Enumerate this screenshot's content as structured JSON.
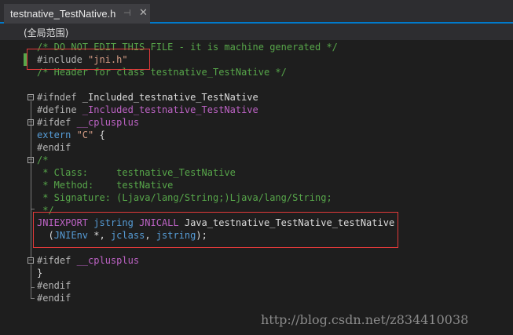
{
  "tab": {
    "title": "testnative_TestNative.h",
    "pin_glyph": "⊣",
    "close_glyph": "✕"
  },
  "navbar": {
    "scope": "(全局范围)"
  },
  "code": {
    "l1": "/* DO NOT EDIT THIS FILE - it is machine generated */",
    "l2_pre": "#include ",
    "l2_str": "\"jni.h\"",
    "l3": "/* Header for class testnative_TestNative */",
    "l5_pre": "#ifndef ",
    "l5_id": "_Included_testnative_TestNative",
    "l6_pre": "#define ",
    "l6_macro": "_Included_testnative_TestNative",
    "l7_pre": "#ifdef ",
    "l7_macro": "__cplusplus",
    "l8_kw": "extern ",
    "l8_str": "\"C\"",
    "l8_rest": " {",
    "l9": "#endif",
    "l10": "/*",
    "l11": " * Class:     testnative_TestNative",
    "l12": " * Method:    testNative",
    "l13": " * Signature: (Ljava/lang/String;)Ljava/lang/String;",
    "l14": " */",
    "l15_m1": "JNIEXPORT",
    "l15_t1": " jstring ",
    "l15_m2": "JNICALL",
    "l15_id": " Java_testnative_TestNative_testNative",
    "l16_p1": "  (",
    "l16_t1": "JNIEnv",
    "l16_p2": " *, ",
    "l16_t2": "jclass",
    "l16_p3": ", ",
    "l16_t3": "jstring",
    "l16_p4": ");",
    "l18_pre": "#ifdef ",
    "l18_macro": "__cplusplus",
    "l19": "}",
    "l20": "#endif",
    "l21": "#endif"
  },
  "watermark": "http://blog.csdn.net/z834410038",
  "colors": {
    "background": "#1e1e1e",
    "accent": "#007acc",
    "comment": "#57a64a",
    "string": "#d69d85",
    "macro": "#bd63c5",
    "keyword": "#569cd6",
    "type": "#4ec9b0",
    "highlight_box": "#e23a3a"
  },
  "icons": {
    "pin": "pin-icon",
    "close": "close-icon",
    "fold": "fold-icon"
  }
}
